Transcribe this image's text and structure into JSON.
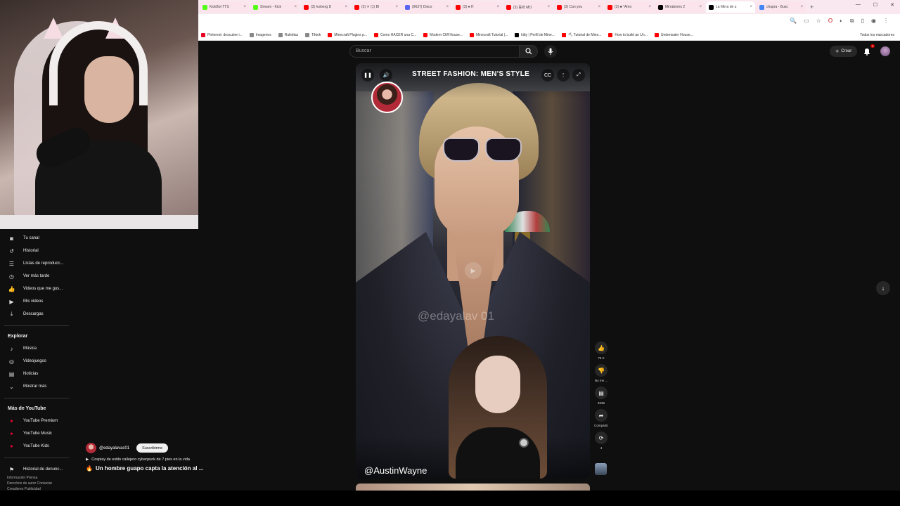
{
  "browser": {
    "tabs": [
      {
        "label": "KickBot TTS",
        "color": "#53fc18"
      },
      {
        "label": "Stream - Kick",
        "color": "#53fc18"
      },
      {
        "label": "(3) Iceberg D",
        "color": "#ff0000"
      },
      {
        "label": "(3) ✕ (1) Bl",
        "color": "#ff0000"
      },
      {
        "label": "(9637) Disco",
        "color": "#5865f2"
      },
      {
        "label": "(3) ● H",
        "color": "#ff0000"
      },
      {
        "label": "(3) 동화 MO",
        "color": "#ff0000"
      },
      {
        "label": "(3) Can you",
        "color": "#ff0000"
      },
      {
        "label": "(3) ♣ \"Amo",
        "color": "#ff0000"
      },
      {
        "label": "Mirrabores 2",
        "color": "#000000"
      },
      {
        "label": "La Mirra de u",
        "color": "#000000"
      },
      {
        "label": "chupra - Busc",
        "color": "#4285f4"
      }
    ],
    "bookmarks": [
      {
        "label": "Pinterest: descubre i...",
        "color": "#e60023"
      },
      {
        "label": "Imagenes",
        "color": "#888888"
      },
      {
        "label": "Ruletitas",
        "color": "#888888"
      },
      {
        "label": "Tiktok",
        "color": "#888888"
      },
      {
        "label": "Minecraft Plugins p...",
        "color": "#ff0000"
      },
      {
        "label": "Como HACER una C...",
        "color": "#ff0000"
      },
      {
        "label": "Modern Cliff House...",
        "color": "#ff0000"
      },
      {
        "label": "Minecraft Tutorial |...",
        "color": "#ff0000"
      },
      {
        "label": "kitty | Perfil de Mine...",
        "color": "#000000"
      },
      {
        "label": "⛏ Tutorial de Mine...",
        "color": "#ff0000"
      },
      {
        "label": "How to build an Un...",
        "color": "#ff0000"
      },
      {
        "label": "Underwater House...",
        "color": "#ff0000"
      }
    ],
    "all_bookmarks": "Todos los marcadores"
  },
  "header": {
    "search_placeholder": "Buscar",
    "create_label": "Crear",
    "notifications_count": "3"
  },
  "sidebar": {
    "you_items": [
      {
        "label": "Tu canal",
        "icon": "channel-icon",
        "glyph": "◙"
      },
      {
        "label": "Historial",
        "icon": "history-icon",
        "glyph": "↺"
      },
      {
        "label": "Listas de reproducc...",
        "icon": "playlists-icon",
        "glyph": "☰"
      },
      {
        "label": "Ver más tarde",
        "icon": "watch-later-icon",
        "glyph": "◷"
      },
      {
        "label": "Videos que me gus...",
        "icon": "liked-icon",
        "glyph": "👍"
      },
      {
        "label": "Mis videos",
        "icon": "my-videos-icon",
        "glyph": "▶"
      },
      {
        "label": "Descargas",
        "icon": "downloads-icon",
        "glyph": "⤓"
      }
    ],
    "explore_title": "Explorar",
    "explore_items": [
      {
        "label": "Música",
        "icon": "music-icon",
        "glyph": "♪"
      },
      {
        "label": "Videojuegos",
        "icon": "gaming-icon",
        "glyph": "◎"
      },
      {
        "label": "Noticias",
        "icon": "news-icon",
        "glyph": "▤"
      },
      {
        "label": "Mostrar más",
        "icon": "chevron-down-icon",
        "glyph": "⌄"
      }
    ],
    "more_title": "Más de YouTube",
    "more_items": [
      {
        "label": "YouTube Premium",
        "icon": "youtube-premium-icon",
        "glyph": "●"
      },
      {
        "label": "YouTube Music",
        "icon": "youtube-music-icon",
        "glyph": "●"
      },
      {
        "label": "YouTube Kids",
        "icon": "youtube-kids-icon",
        "glyph": "●"
      }
    ],
    "report_history": "Historial de denunc...",
    "footer": [
      "Información  Prensa",
      "Derechos de autor  Contactar",
      "Creadores  Publicidad"
    ]
  },
  "player": {
    "overlay_title": "STREET FASHION: MEN'S STYLE",
    "watermark": "@edayalav 01",
    "credit": "@AustinWayne"
  },
  "actions": {
    "like_count": "76 K",
    "dislike_label": "No me ...",
    "comments_count": "3336",
    "share_label": "Compartir",
    "remix_count": "4"
  },
  "video_info": {
    "channel": "@edayalavac01",
    "subscribe_label": "Suscribirme",
    "playlist": "Cosplay de estilo callejero cyberpunk de 7 pies en la vida",
    "title": "Un hombre guapo capta la atención al ..."
  }
}
